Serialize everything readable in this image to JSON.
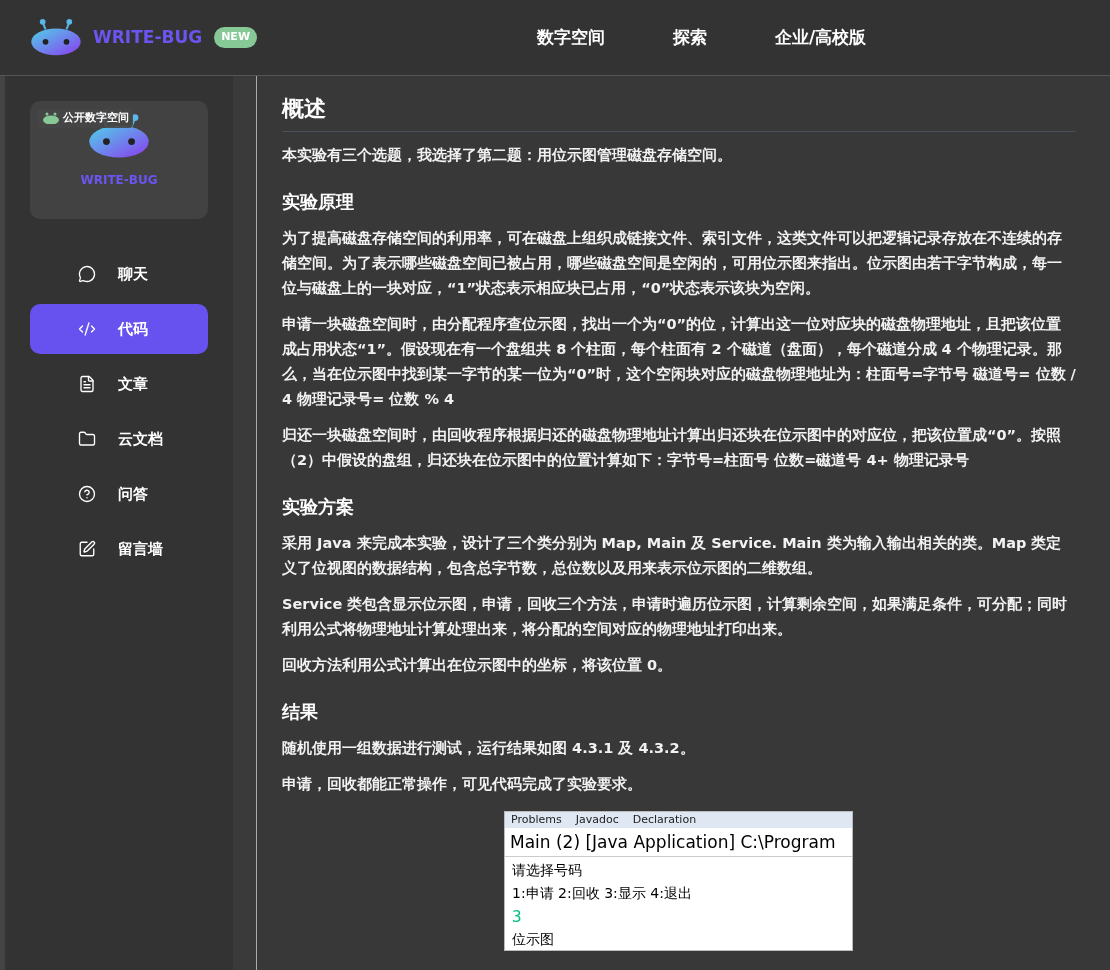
{
  "header": {
    "brand": "WRITE-BUG",
    "badge": "NEW",
    "nav": [
      {
        "label": "数字空间"
      },
      {
        "label": "探索"
      },
      {
        "label": "企业/高校版"
      }
    ]
  },
  "sidebar": {
    "card": {
      "tag": "公开数字空间",
      "brand": "WRITE-BUG"
    },
    "items": [
      {
        "label": "聊天",
        "selected": false
      },
      {
        "label": "代码",
        "selected": true
      },
      {
        "label": "文章",
        "selected": false
      },
      {
        "label": "云文档",
        "selected": false
      },
      {
        "label": "问答",
        "selected": false
      },
      {
        "label": "留言墙",
        "selected": false
      }
    ]
  },
  "article": {
    "title": "概述",
    "blocks": [
      {
        "kind": "p",
        "text": "本实验有三个选题，我选择了第二题：用位示图管理磁盘存储空间。"
      },
      {
        "kind": "h",
        "text": "实验原理"
      },
      {
        "kind": "p",
        "text": "为了提高磁盘存储空间的利用率，可在磁盘上组织成链接文件、索引文件，这类文件可以把逻辑记录存放在不连续的存储空间。为了表示哪些磁盘空间已被占用，哪些磁盘空间是空闲的，可用位示图来指出。位示图由若干字节构成，每一位与磁盘上的一块对应，“1”状态表示相应块已占用，“0”状态表示该块为空闲。"
      },
      {
        "kind": "p",
        "text": "申请一块磁盘空间时，由分配程序查位示图，找出一个为“0”的位，计算出这一位对应块的磁盘物理地址，且把该位置成占用状态“1”。假设现在有一个盘组共 8 个柱面，每个柱面有 2 个磁道（盘面），每个磁道分成 4 个物理记录。那么，当在位示图中找到某一字节的某一位为“0”时，这个空闲块对应的磁盘物理地址为：柱面号=字节号 磁道号= 位数 / 4 物理记录号= 位数 % 4"
      },
      {
        "kind": "p",
        "text": "归还一块磁盘空间时，由回收程序根据归还的磁盘物理地址计算出归还块在位示图中的对应位，把该位置成“0”。按照（2）中假设的盘组，归还块在位示图中的位置计算如下：字节号=柱面号 位数=磁道号 4+ 物理记录号"
      },
      {
        "kind": "h",
        "text": "实验方案"
      },
      {
        "kind": "p",
        "text": "采用 Java 来完成本实验，设计了三个类分别为 Map, Main 及 Service. Main 类为输入输出相关的类。Map 类定义了位视图的数据结构，包含总字节数，总位数以及用来表示位示图的二维数组。"
      },
      {
        "kind": "p",
        "text": "Service 类包含显示位示图，申请，回收三个方法，申请时遍历位示图，计算剩余空间，如果满足条件，可分配；同时利用公式将物理地址计算处理出来，将分配的空间对应的物理地址打印出来。"
      },
      {
        "kind": "p",
        "text": "回收方法利用公式计算出在位示图中的坐标，将该位置 0。"
      },
      {
        "kind": "h",
        "text": "结果"
      },
      {
        "kind": "p",
        "text": "随机使用一组数据进行测试，运行结果如图 4.3.1 及 4.3.2。"
      },
      {
        "kind": "p",
        "text": "申请，回收都能正常操作，可见代码完成了实验要求。"
      }
    ],
    "console": {
      "tabs": [
        "Problems",
        "Javadoc",
        "Declaration"
      ],
      "title": "Main (2) [Java Application] C:\\Program",
      "lines": [
        {
          "kind": "out",
          "text": "请选择号码"
        },
        {
          "kind": "out",
          "text": "1:申请 2:回收 3:显示 4:退出"
        },
        {
          "kind": "in",
          "text": "3"
        },
        {
          "kind": "out",
          "text": "位示图"
        }
      ]
    }
  }
}
